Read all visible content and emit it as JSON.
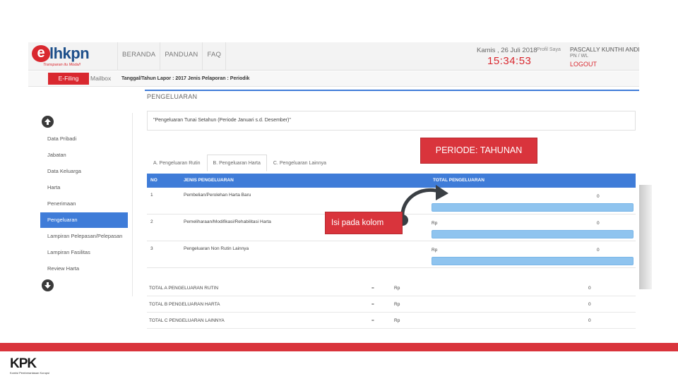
{
  "logo": {
    "letter": "e",
    "name": "lhkpn",
    "tagline": "Transparan itu Modal!"
  },
  "nav": [
    "BERANDA",
    "PANDUAN",
    "FAQ"
  ],
  "header": {
    "date": "Kamis , 26 Juli 2018",
    "time": "15:34:53",
    "profile_label": "Profil Saya",
    "user_name": "PASCALLY KUNTHI ANDINI",
    "user_sub": "PN / WL",
    "logout": "LOGOUT"
  },
  "subbar": {
    "efiling": "E-Filing",
    "mailbox": "Mailbox",
    "info": "Tanggal/Tahun Lapor : 2017   Jenis Pelaporan : Periodik"
  },
  "sidebar": {
    "items": [
      "Data Pribadi",
      "Jabatan",
      "Data Keluarga",
      "Harta",
      "Penerimaan",
      "Pengeluaran",
      "Lampiran Pelepasan/Pelepasan",
      "Lampiran Fasilitas",
      "Review Harta"
    ],
    "active_index": 5
  },
  "main": {
    "title": "PENGELUARAN",
    "description": "\"Pengeluaran Tunai Setahun (Periode Januari s.d. Desember)\"",
    "tabs": [
      "A. Pengeluaran Rutin",
      "B. Pengeluaran Harta",
      "C. Pengeluaran Lainnya"
    ],
    "active_tab": 1
  },
  "table": {
    "headers": [
      "NO",
      "JENIS PENGELUARAN",
      "TOTAL PENGELUARAN"
    ],
    "rows": [
      {
        "no": "1",
        "jenis": "Pembelian/Perolehan Harta Baru",
        "rp": "",
        "total": "0"
      },
      {
        "no": "2",
        "jenis": "Pemeliharaan/Modifikasi/Rehabilitasi Harta",
        "rp": "Rp",
        "total": "0"
      },
      {
        "no": "3",
        "jenis": "Pengeluaran Non Rutin Lainnya",
        "rp": "Rp",
        "total": "0"
      }
    ]
  },
  "totals": [
    {
      "label": "TOTAL A PENGELUARAN RUTIN",
      "eq": "=",
      "rp": "Rp",
      "value": "0"
    },
    {
      "label": "TOTAL B PENGELUARAN HARTA",
      "eq": "=",
      "rp": "Rp",
      "value": "0"
    },
    {
      "label": "TOTAL C PENGELUARAN LAINNYA",
      "eq": "=",
      "rp": "Rp",
      "value": "0"
    }
  ],
  "annotations": {
    "periode": "PERIODE: TAHUNAN",
    "isi": "Isi pada kolom"
  },
  "footer": {
    "logo_text": "KPK",
    "logo_sub": "Komisi Pemberantasan Korupsi"
  },
  "colors": {
    "accent_blue": "#3f7cd8",
    "brand_red": "#d9282f",
    "annotation_red": "#d9343c",
    "input_blue": "#8fc4ef"
  }
}
